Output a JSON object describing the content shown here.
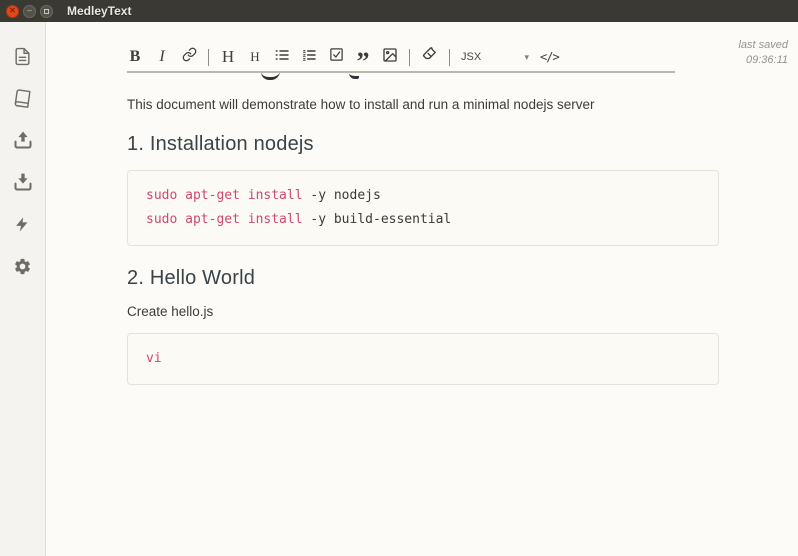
{
  "window": {
    "title": "MedleyText",
    "controls": {
      "close": "✕",
      "minimize": "–"
    }
  },
  "sidebar": {
    "items": [
      {
        "name": "notes",
        "icon": "document-icon"
      },
      {
        "name": "notebooks",
        "icon": "book-icon"
      },
      {
        "name": "upload",
        "icon": "upload-icon"
      },
      {
        "name": "download",
        "icon": "download-icon"
      },
      {
        "name": "shortcuts",
        "icon": "lightning-icon"
      },
      {
        "name": "settings",
        "icon": "gear-icon"
      }
    ]
  },
  "toolbar": {
    "bold_label": "B",
    "italic_label": "I",
    "heading_large_label": "H",
    "heading_small_label": "H",
    "quote_label": "”",
    "syntax_select_value": "JSX",
    "syntax_caret": "▾",
    "code_label": "</>"
  },
  "status": {
    "last_saved_label": "last saved",
    "last_saved_time": "09:36:11"
  },
  "document": {
    "intro": "This document will demonstrate how to install and run a minimal nodejs server",
    "section1": {
      "heading": "1. Installation nodejs",
      "code": {
        "line1": {
          "keyword": "sudo apt-get install",
          "rest": " -y nodejs"
        },
        "line2": {
          "keyword": "sudo apt-get install",
          "rest": " -y build-essential"
        }
      }
    },
    "section2": {
      "heading": "2. Hello World",
      "paragraph": "Create hello.js",
      "code": {
        "line1": {
          "keyword": "vi",
          "rest": ""
        }
      }
    }
  },
  "colors": {
    "titlebar_bg": "#3a3934",
    "close_button": "#df4a16",
    "sidebar_bg": "#f4f3ef",
    "main_bg": "#fcfbf7",
    "code_block_bg": "#fbfaf4",
    "code_block_border": "#e5e2d9",
    "code_keyword": "#d0486c",
    "heading_text": "#3a4347"
  }
}
